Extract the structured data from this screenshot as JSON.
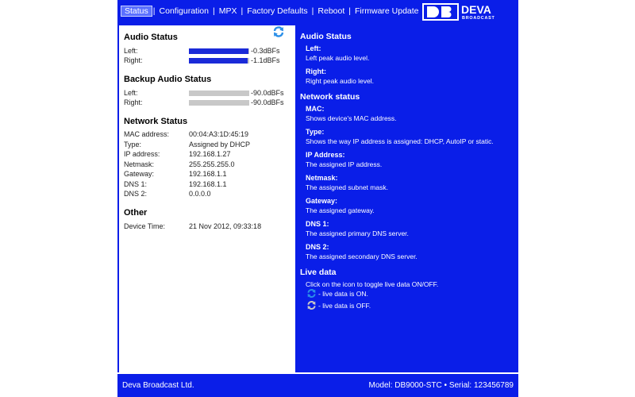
{
  "nav": {
    "items": [
      "Status",
      "Configuration",
      "MPX",
      "Factory Defaults",
      "Reboot",
      "Firmware Update"
    ],
    "active": "Status"
  },
  "logo": {
    "text": "DEVA",
    "sub": "BROADCAST"
  },
  "left": {
    "audio_status": {
      "title": "Audio Status",
      "rows": [
        {
          "label": "Left:",
          "value": "-0.3dBFs",
          "level": 0.99
        },
        {
          "label": "Right:",
          "value": "-1.1dBFs",
          "level": 0.97
        }
      ]
    },
    "backup_audio": {
      "title": "Backup Audio Status",
      "rows": [
        {
          "label": "Left:",
          "value": "-90.0dBFs",
          "level": 0.0
        },
        {
          "label": "Right:",
          "value": "-90.0dBFs",
          "level": 0.0
        }
      ]
    },
    "network": {
      "title": "Network Status",
      "rows": [
        {
          "label": "MAC address:",
          "value": "00:04:A3:1D:45:19"
        },
        {
          "label": "Type:",
          "value": "Assigned by DHCP"
        },
        {
          "label": "IP address:",
          "value": "192.168.1.27"
        },
        {
          "label": "Netmask:",
          "value": "255.255.255.0"
        },
        {
          "label": "Gateway:",
          "value": "192.168.1.1"
        },
        {
          "label": "DNS 1:",
          "value": "192.168.1.1"
        },
        {
          "label": "DNS 2:",
          "value": "0.0.0.0"
        }
      ]
    },
    "other": {
      "title": "Other",
      "rows": [
        {
          "label": "Device Time:",
          "value": "21 Nov 2012, 09:33:18"
        }
      ]
    }
  },
  "help": {
    "audio_title": "Audio Status",
    "left_t": "Left:",
    "left_d": "Left peak audio level.",
    "right_t": "Right:",
    "right_d": "Right peak audio level.",
    "net_title": "Network status",
    "mac_t": "MAC:",
    "mac_d": "Shows device's MAC address.",
    "type_t": "Type:",
    "type_d": "Shows the way IP address is assigned: DHCP, AutoIP or static.",
    "ip_t": "IP Address:",
    "ip_d": "The assigned IP address.",
    "nm_t": "Netmask:",
    "nm_d": "The assigned subnet mask.",
    "gw_t": "Gateway:",
    "gw_d": "The assigned gateway.",
    "d1_t": "DNS 1:",
    "d1_d": "The assigned primary DNS server.",
    "d2_t": "DNS 2:",
    "d2_d": "The assigned secondary DNS server.",
    "live_title": "Live data",
    "live_d": "Click on the icon to toggle live data ON/OFF.",
    "live_on": "- live data is ON.",
    "live_off": "- live data is OFF."
  },
  "footer": {
    "company": "Deva Broadcast Ltd.",
    "model": "Model: DB9000-STC • Serial: 123456789"
  },
  "colors": {
    "brand_blue": "#0a1ee8",
    "meter_blue": "#1a2ad8",
    "meter_grey": "#c8c8c8"
  }
}
